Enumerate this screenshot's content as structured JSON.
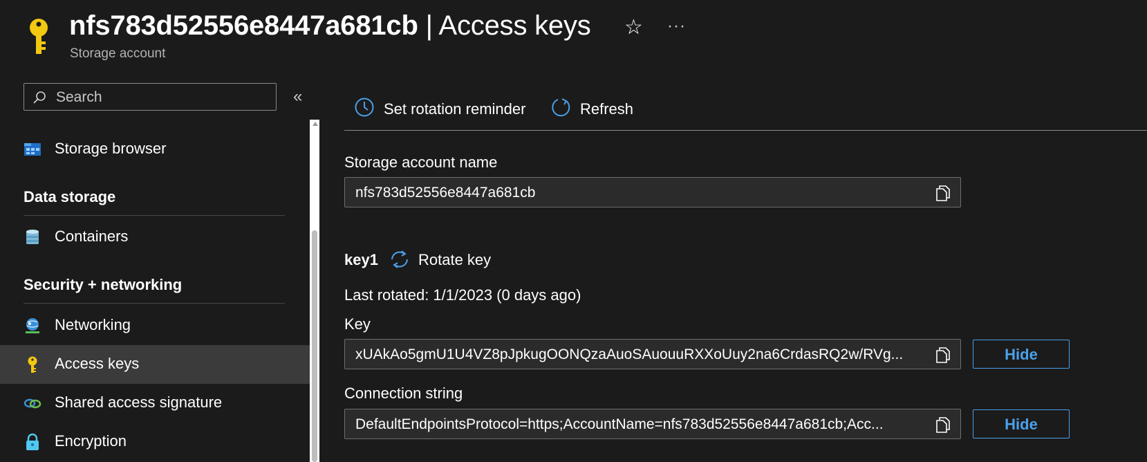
{
  "header": {
    "account_name": "nfs783d52556e8447a681cb",
    "separator": " | ",
    "page_title": "Access keys",
    "subtitle": "Storage account",
    "star_icon": "☆",
    "more_icon": "···"
  },
  "sidebar": {
    "search_placeholder": "Search",
    "collapse_icon": "«",
    "items": [
      {
        "label": "Storage browser",
        "icon": "storage-browser-icon"
      },
      {
        "label": "Containers",
        "icon": "containers-icon"
      },
      {
        "label": "Networking",
        "icon": "networking-icon"
      },
      {
        "label": "Access keys",
        "icon": "key-icon",
        "active": true
      },
      {
        "label": "Shared access signature",
        "icon": "link-icon"
      },
      {
        "label": "Encryption",
        "icon": "lock-icon"
      }
    ],
    "sections": {
      "data_storage": "Data storage",
      "security_networking": "Security + networking"
    }
  },
  "toolbar": {
    "reminder_label": "Set rotation reminder",
    "refresh_label": "Refresh"
  },
  "main": {
    "account_name_label": "Storage account name",
    "account_name_value": "nfs783d52556e8447a681cb",
    "key1": {
      "title": "key1",
      "rotate_label": "Rotate key",
      "last_rotated": "Last rotated: 1/1/2023 (0 days ago)",
      "key_label": "Key",
      "key_value": "xUAkAo5gmU1U4VZ8pJpkugOONQzaAuoSAuouuRXXoUuy2na6CrdasRQ2w/RVg...",
      "key_hide_label": "Hide",
      "conn_label": "Connection string",
      "conn_value": "DefaultEndpointsProtocol=https;AccountName=nfs783d52556e8447a681cb;Acc...",
      "conn_hide_label": "Hide"
    }
  },
  "colors": {
    "accent": "#4ba0ea",
    "background": "#1b1b1b",
    "active_nav": "#3b3b3b",
    "key_yellow": "#f2c811"
  }
}
